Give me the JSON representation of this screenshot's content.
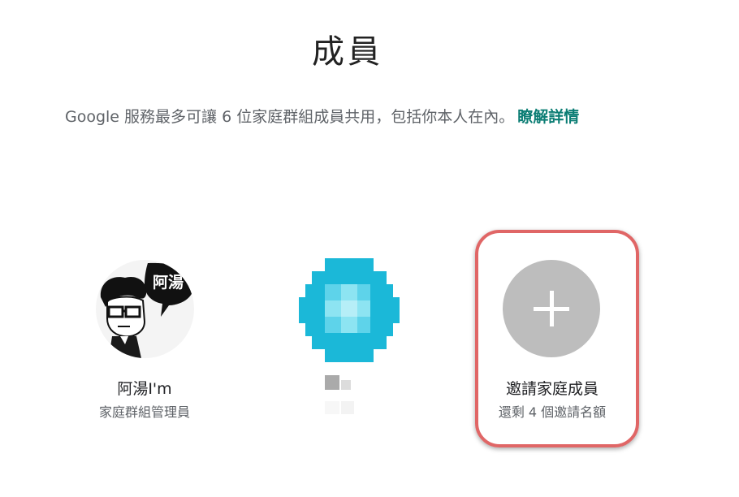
{
  "page": {
    "title": "成員",
    "description": "Google 服務最多可讓 6 位家庭群組成員共用，包括你本人在內。",
    "learn_more": "瞭解詳情"
  },
  "members": [
    {
      "name": "阿湯I'm",
      "role": "家庭群組管理員",
      "avatar_text": "阿湯"
    },
    {
      "name": "",
      "role": "",
      "avatar_state": "pixelated"
    }
  ],
  "invite": {
    "label": "邀請家庭成員",
    "remaining": "還剩 4 個邀請名額",
    "icon": "plus-icon"
  },
  "colors": {
    "link": "#0b7d74",
    "invite_circle": "#bdbdbd",
    "highlight_border": "#e06666",
    "pixel_avatar": "#1bb8d8"
  }
}
